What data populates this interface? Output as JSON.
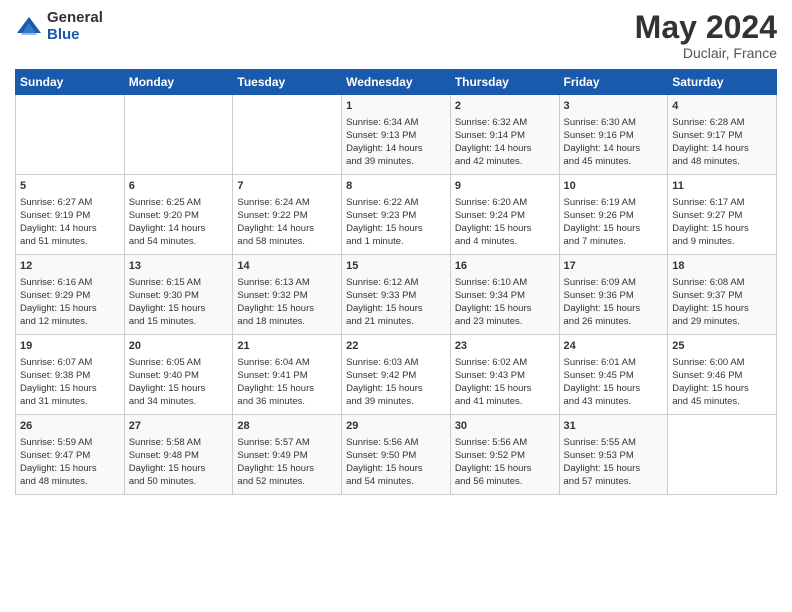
{
  "header": {
    "logo_general": "General",
    "logo_blue": "Blue",
    "title": "May 2024",
    "subtitle": "Duclair, France"
  },
  "days_of_week": [
    "Sunday",
    "Monday",
    "Tuesday",
    "Wednesday",
    "Thursday",
    "Friday",
    "Saturday"
  ],
  "weeks": [
    [
      {
        "day": "",
        "info": ""
      },
      {
        "day": "",
        "info": ""
      },
      {
        "day": "",
        "info": ""
      },
      {
        "day": "1",
        "info": "Sunrise: 6:34 AM\nSunset: 9:13 PM\nDaylight: 14 hours\nand 39 minutes."
      },
      {
        "day": "2",
        "info": "Sunrise: 6:32 AM\nSunset: 9:14 PM\nDaylight: 14 hours\nand 42 minutes."
      },
      {
        "day": "3",
        "info": "Sunrise: 6:30 AM\nSunset: 9:16 PM\nDaylight: 14 hours\nand 45 minutes."
      },
      {
        "day": "4",
        "info": "Sunrise: 6:28 AM\nSunset: 9:17 PM\nDaylight: 14 hours\nand 48 minutes."
      }
    ],
    [
      {
        "day": "5",
        "info": "Sunrise: 6:27 AM\nSunset: 9:19 PM\nDaylight: 14 hours\nand 51 minutes."
      },
      {
        "day": "6",
        "info": "Sunrise: 6:25 AM\nSunset: 9:20 PM\nDaylight: 14 hours\nand 54 minutes."
      },
      {
        "day": "7",
        "info": "Sunrise: 6:24 AM\nSunset: 9:22 PM\nDaylight: 14 hours\nand 58 minutes."
      },
      {
        "day": "8",
        "info": "Sunrise: 6:22 AM\nSunset: 9:23 PM\nDaylight: 15 hours\nand 1 minute."
      },
      {
        "day": "9",
        "info": "Sunrise: 6:20 AM\nSunset: 9:24 PM\nDaylight: 15 hours\nand 4 minutes."
      },
      {
        "day": "10",
        "info": "Sunrise: 6:19 AM\nSunset: 9:26 PM\nDaylight: 15 hours\nand 7 minutes."
      },
      {
        "day": "11",
        "info": "Sunrise: 6:17 AM\nSunset: 9:27 PM\nDaylight: 15 hours\nand 9 minutes."
      }
    ],
    [
      {
        "day": "12",
        "info": "Sunrise: 6:16 AM\nSunset: 9:29 PM\nDaylight: 15 hours\nand 12 minutes."
      },
      {
        "day": "13",
        "info": "Sunrise: 6:15 AM\nSunset: 9:30 PM\nDaylight: 15 hours\nand 15 minutes."
      },
      {
        "day": "14",
        "info": "Sunrise: 6:13 AM\nSunset: 9:32 PM\nDaylight: 15 hours\nand 18 minutes."
      },
      {
        "day": "15",
        "info": "Sunrise: 6:12 AM\nSunset: 9:33 PM\nDaylight: 15 hours\nand 21 minutes."
      },
      {
        "day": "16",
        "info": "Sunrise: 6:10 AM\nSunset: 9:34 PM\nDaylight: 15 hours\nand 23 minutes."
      },
      {
        "day": "17",
        "info": "Sunrise: 6:09 AM\nSunset: 9:36 PM\nDaylight: 15 hours\nand 26 minutes."
      },
      {
        "day": "18",
        "info": "Sunrise: 6:08 AM\nSunset: 9:37 PM\nDaylight: 15 hours\nand 29 minutes."
      }
    ],
    [
      {
        "day": "19",
        "info": "Sunrise: 6:07 AM\nSunset: 9:38 PM\nDaylight: 15 hours\nand 31 minutes."
      },
      {
        "day": "20",
        "info": "Sunrise: 6:05 AM\nSunset: 9:40 PM\nDaylight: 15 hours\nand 34 minutes."
      },
      {
        "day": "21",
        "info": "Sunrise: 6:04 AM\nSunset: 9:41 PM\nDaylight: 15 hours\nand 36 minutes."
      },
      {
        "day": "22",
        "info": "Sunrise: 6:03 AM\nSunset: 9:42 PM\nDaylight: 15 hours\nand 39 minutes."
      },
      {
        "day": "23",
        "info": "Sunrise: 6:02 AM\nSunset: 9:43 PM\nDaylight: 15 hours\nand 41 minutes."
      },
      {
        "day": "24",
        "info": "Sunrise: 6:01 AM\nSunset: 9:45 PM\nDaylight: 15 hours\nand 43 minutes."
      },
      {
        "day": "25",
        "info": "Sunrise: 6:00 AM\nSunset: 9:46 PM\nDaylight: 15 hours\nand 45 minutes."
      }
    ],
    [
      {
        "day": "26",
        "info": "Sunrise: 5:59 AM\nSunset: 9:47 PM\nDaylight: 15 hours\nand 48 minutes."
      },
      {
        "day": "27",
        "info": "Sunrise: 5:58 AM\nSunset: 9:48 PM\nDaylight: 15 hours\nand 50 minutes."
      },
      {
        "day": "28",
        "info": "Sunrise: 5:57 AM\nSunset: 9:49 PM\nDaylight: 15 hours\nand 52 minutes."
      },
      {
        "day": "29",
        "info": "Sunrise: 5:56 AM\nSunset: 9:50 PM\nDaylight: 15 hours\nand 54 minutes."
      },
      {
        "day": "30",
        "info": "Sunrise: 5:56 AM\nSunset: 9:52 PM\nDaylight: 15 hours\nand 56 minutes."
      },
      {
        "day": "31",
        "info": "Sunrise: 5:55 AM\nSunset: 9:53 PM\nDaylight: 15 hours\nand 57 minutes."
      },
      {
        "day": "",
        "info": ""
      }
    ]
  ]
}
